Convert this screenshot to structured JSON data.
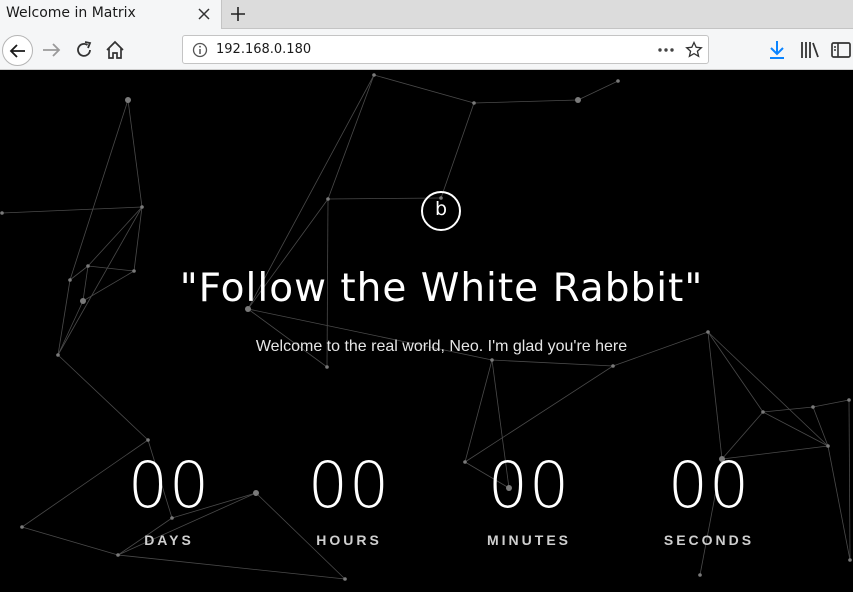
{
  "browser": {
    "tab_title": "Welcome in Matrix",
    "url": "192.168.0.180",
    "accent_color": "#0a84ff"
  },
  "icons": {
    "tab_close": "close-icon",
    "new_tab": "plus-icon",
    "back": "back-arrow-icon",
    "forward": "forward-arrow-icon",
    "reload": "reload-icon",
    "home": "home-icon",
    "site_info": "info-icon",
    "page_actions": "more-dots-icon",
    "bookmark": "star-icon",
    "downloads": "download-icon",
    "library": "library-icon",
    "sidebar": "sidebar-icon"
  },
  "page": {
    "logo_letter": "b",
    "headline": "\"Follow the White Rabbit\"",
    "subheadline": "Welcome to the real world, Neo. I'm glad you're here",
    "background_color": "#000000",
    "countdown": [
      {
        "value": "00",
        "label": "DAYS"
      },
      {
        "value": "00",
        "label": "HOURS"
      },
      {
        "value": "00",
        "label": "MINUTES"
      },
      {
        "value": "00",
        "label": "SECONDS"
      }
    ]
  }
}
